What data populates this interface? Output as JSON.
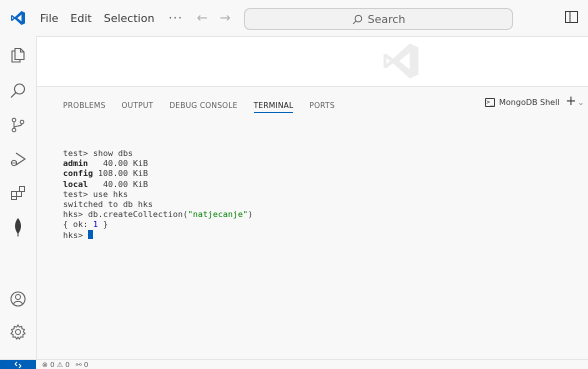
{
  "titlebar": {
    "menu": [
      "File",
      "Edit",
      "Selection"
    ],
    "more": "···",
    "search_placeholder": "Search"
  },
  "activitybar": {
    "items": [
      "explorer-icon",
      "search-icon",
      "source-control-icon",
      "run-debug-icon",
      "extensions-icon",
      "mongodb-icon"
    ],
    "bottom": [
      "account-icon",
      "manage-gear-icon"
    ]
  },
  "panel": {
    "tabs": [
      "PROBLEMS",
      "OUTPUT",
      "DEBUG CONSOLE",
      "TERMINAL",
      "PORTS"
    ],
    "active_tab": "TERMINAL",
    "terminal_name": "MongoDB Shell"
  },
  "terminal": {
    "cmd1": "test> show dbs",
    "dbs": [
      {
        "name": "admin",
        "size": "40.00 KiB"
      },
      {
        "name": "config",
        "size": "108.00 KiB"
      },
      {
        "name": "local",
        "size": "40.00 KiB"
      }
    ],
    "cmd2": "test> use hks",
    "out2": "switched to db hks",
    "cmd3_prefix": "hks> db.createCollection(",
    "cmd3_arg": "\"natjecanje\"",
    "cmd3_suffix": ")",
    "out3_prefix": "{ ok: ",
    "out3_value": "1",
    "out3_suffix": " }",
    "prompt": "hks> "
  },
  "statusbar": {
    "errors": "0",
    "warnings": "0",
    "ports": "0"
  },
  "colors": {
    "accent": "#005fb8",
    "string": "#008000",
    "number": "#0000c0"
  }
}
